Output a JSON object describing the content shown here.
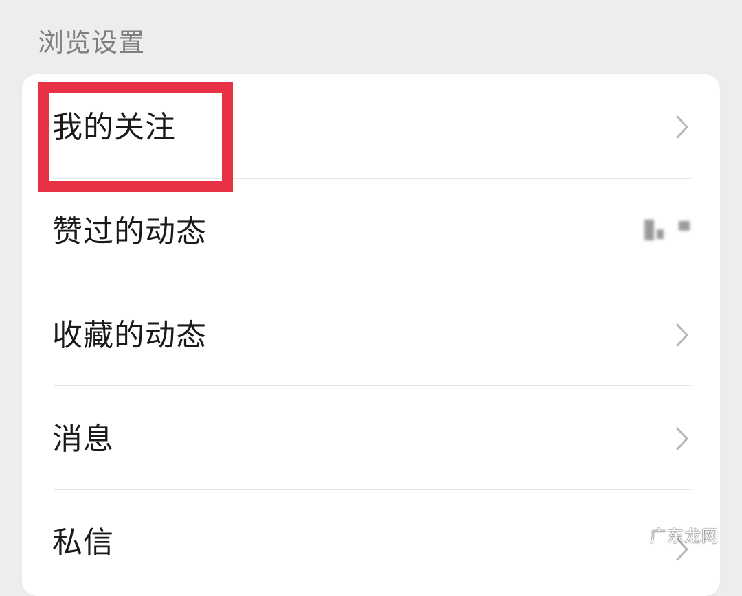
{
  "section": {
    "title": "浏览设置"
  },
  "settings": {
    "items": [
      {
        "label": "我的关注",
        "chevron": "chevron-right-icon"
      },
      {
        "label": "赞过的动态",
        "chevron": "none"
      },
      {
        "label": "收藏的动态",
        "chevron": "chevron-right-icon"
      },
      {
        "label": "消息",
        "chevron": "chevron-right-icon"
      },
      {
        "label": "私信",
        "chevron": "chevron-right-icon"
      }
    ]
  },
  "highlight": {
    "target": "我的关注",
    "color": "#e63244"
  },
  "watermark": {
    "text": "广东龙网"
  },
  "colors": {
    "background": "#ededed",
    "card": "#ffffff",
    "label": "#1a1a1a",
    "header": "#7f7f7f",
    "chevron": "#b5b5b5",
    "divider": "#e5e5e5"
  }
}
